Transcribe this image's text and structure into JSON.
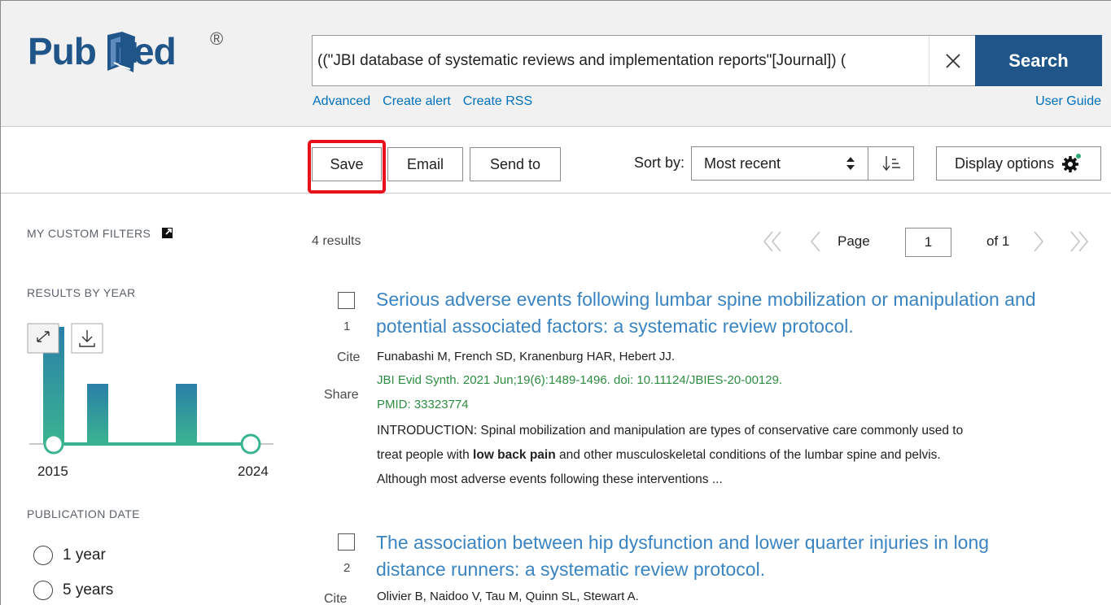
{
  "header": {
    "logo": {
      "text_pub": "Pub",
      "text_med": "ed",
      "reg": "®"
    },
    "search": {
      "query": "((\"JBI database of systematic reviews and implementation reports\"[Journal]) (",
      "button_label": "Search"
    },
    "links": [
      "Advanced",
      "Create alert",
      "Create RSS"
    ],
    "user_guide": "User Guide"
  },
  "toolbar": {
    "save_label": "Save",
    "email_label": "Email",
    "send_to_label": "Send to",
    "sort_label": "Sort by:",
    "sort_value": "Most recent",
    "display_options_label": "Display options"
  },
  "sidebar": {
    "custom_filters_heading": "MY CUSTOM FILTERS",
    "results_by_year_heading": "RESULTS BY YEAR",
    "year_start": "2015",
    "year_end": "2024",
    "publication_date_heading": "PUBLICATION DATE",
    "date_options": [
      "1 year",
      "5 years"
    ]
  },
  "results": {
    "count_text": "4 results",
    "page_label": "Page",
    "page_value": "1",
    "page_of": "of 1",
    "items": [
      {
        "num": "1",
        "cite": "Cite",
        "share": "Share",
        "title_line1": "Serious adverse events following lumbar spine mobilization or manipulation and",
        "title_line2": "potential associated factors: a systematic review protocol.",
        "authors": "Funabashi M, French SD, Kranenburg HAR, Hebert JJ.",
        "citation": "JBI Evid Synth. 2021 Jun;19(6):1489-1496. doi: 10.11124/JBIES-20-00129.",
        "pmid": "PMID: 33323774",
        "snippet_line1": "INTRODUCTION: Spinal mobilization and manipulation are types of conservative care commonly used to",
        "snippet_line2_pre": "treat people with ",
        "snippet_line2_bold": "low back pain",
        "snippet_line2_post": " and other musculoskeletal conditions of the lumbar spine and pelvis.",
        "snippet_line3": "Although most adverse events following these interventions ..."
      },
      {
        "num": "2",
        "cite": "Cite",
        "title_line1": "The association between hip dysfunction and lower quarter injuries in long",
        "title_line2": "distance runners: a systematic review protocol.",
        "authors": "Olivier B, Naidoo V, Tau M, Quinn SL, Stewart A."
      }
    ]
  },
  "colors": {
    "brand": "#20558a",
    "link": "#0071bc",
    "title_link": "#3a84c2",
    "citation": "#2e8b42",
    "highlight": "#e8101a",
    "bar": "#3aaf95"
  }
}
